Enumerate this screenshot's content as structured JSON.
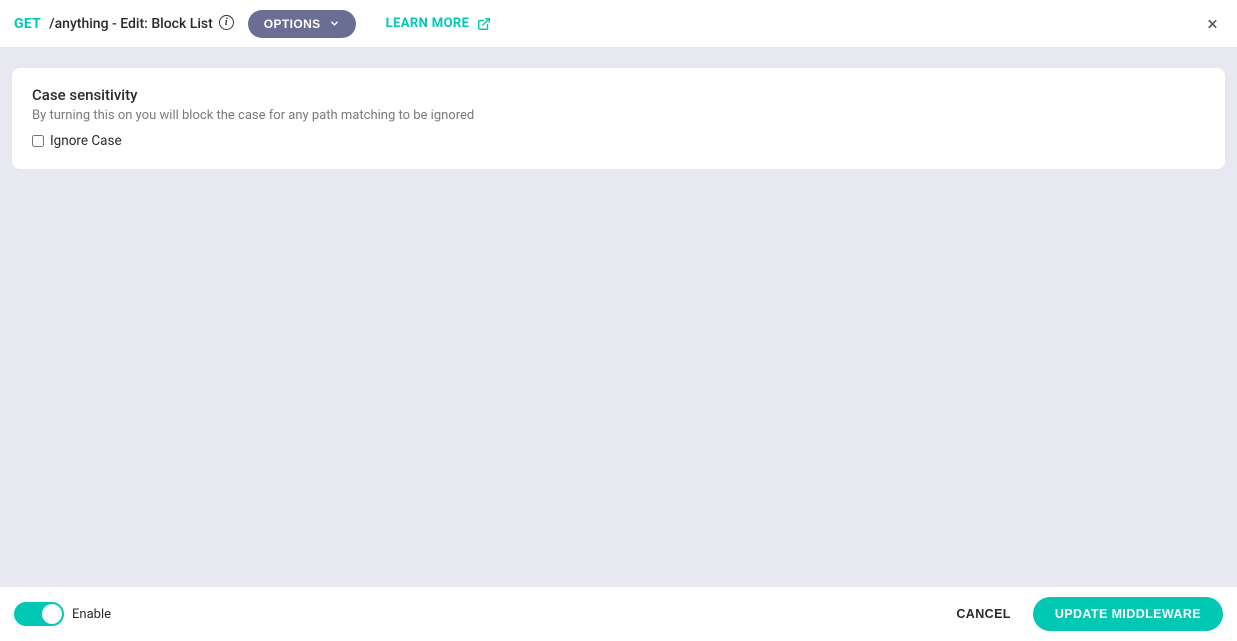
{
  "header": {
    "method": "GET",
    "title": "/anything - Edit: Block List",
    "options_label": "OPTIONS",
    "learn_more_label": "LEARN MORE"
  },
  "card": {
    "title": "Case sensitivity",
    "description": "By turning this on you will block the case for any path matching to be ignored",
    "checkbox_label": "Ignore Case"
  },
  "footer": {
    "enable_label": "Enable",
    "cancel_label": "CANCEL",
    "update_label": "UPDATE MIDDLEWARE"
  }
}
